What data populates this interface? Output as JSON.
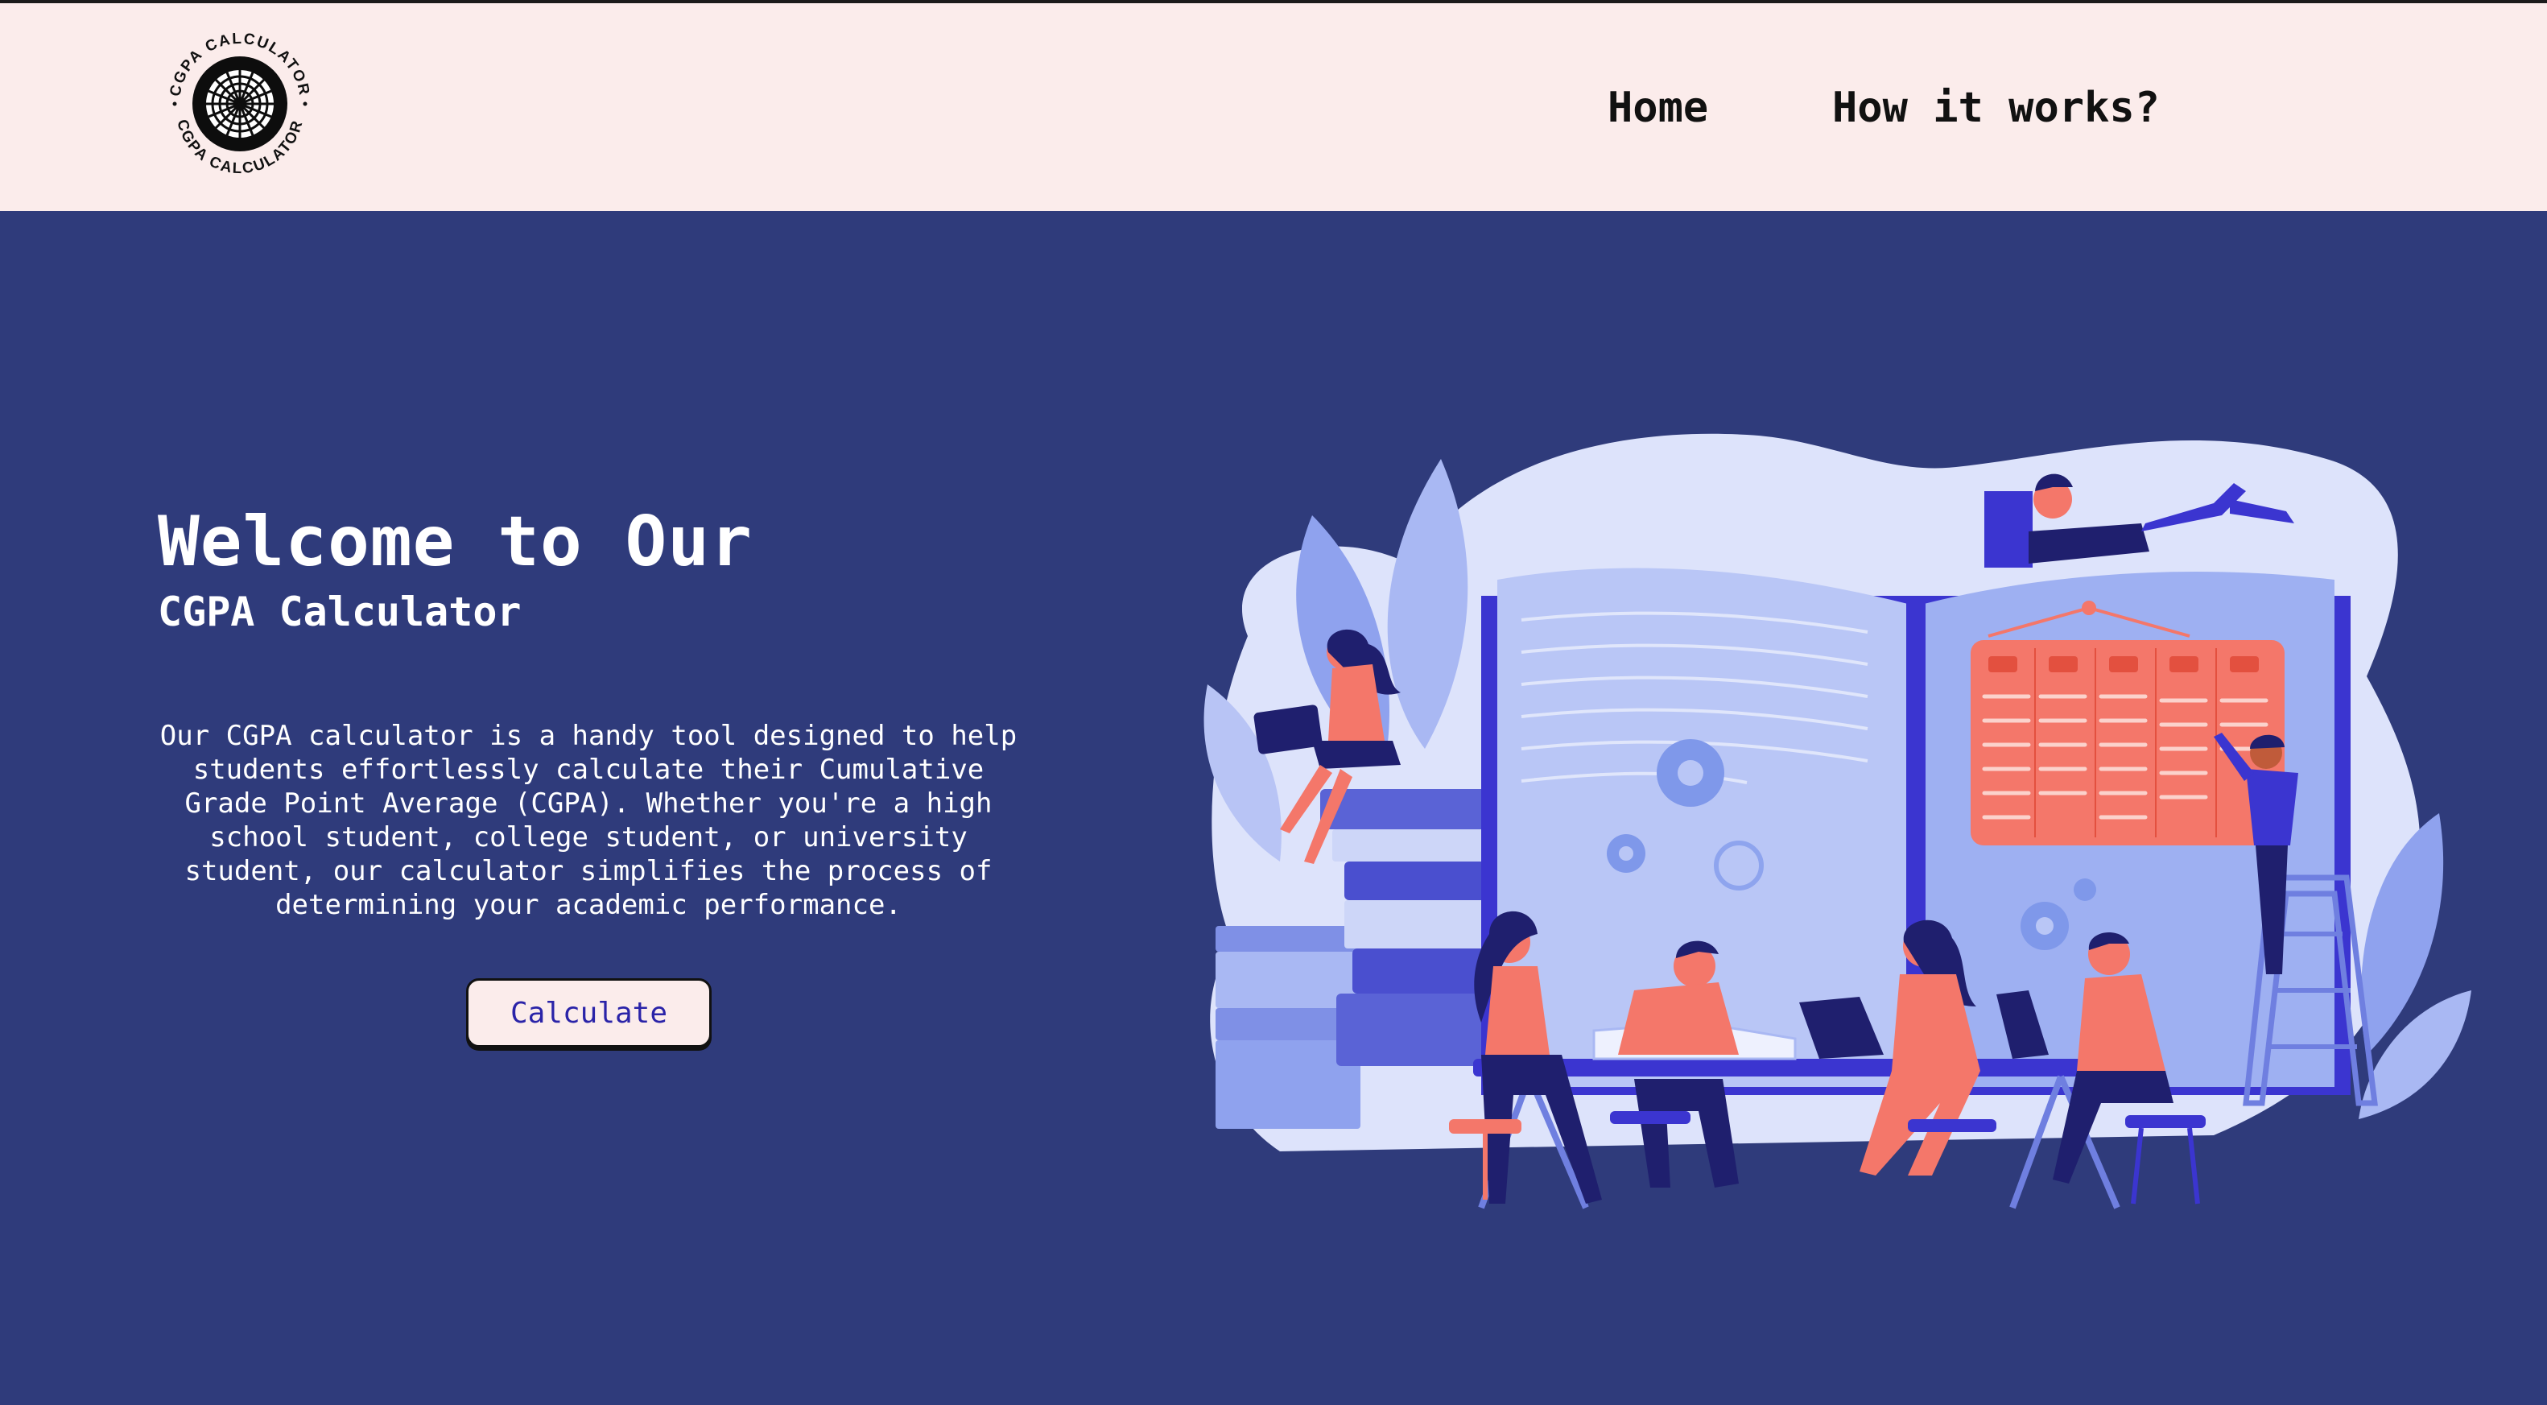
{
  "header": {
    "logo_text": "CGPA CALCULATOR",
    "nav": {
      "home": "Home",
      "how_it_works": "How it works?"
    }
  },
  "hero": {
    "title": "Welcome to Our",
    "subtitle": "CGPA Calculator",
    "description": "Our CGPA calculator is a handy tool designed to help students effortlessly calculate their Cumulative Grade Point Average (CGPA). Whether you're a high school student, college student, or university student, our calculator simplifies the process of determining your academic performance.",
    "button_label": "Calculate"
  },
  "colors": {
    "page_bg": "#2f3b7b",
    "navbar_bg": "#fbeceb",
    "button_text": "#2a23a8",
    "accent_coral": "#f4776a",
    "accent_indigo": "#3b35d0"
  },
  "icons": {
    "logo": "circular-seal-logo",
    "illustration": "students-studying-illustration"
  }
}
